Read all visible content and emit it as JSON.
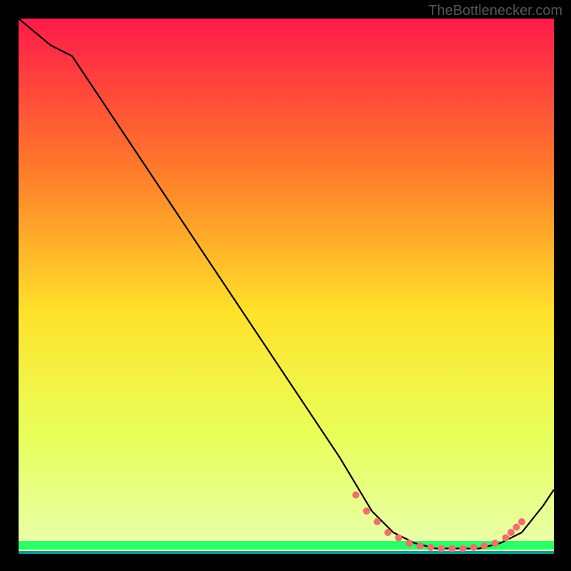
{
  "watermark": "TheBottlenecker.com",
  "chart_data": {
    "type": "line",
    "title": "",
    "xlabel": "",
    "ylabel": "",
    "xlim": [
      0,
      100
    ],
    "ylim": [
      0,
      100
    ],
    "background_gradient": {
      "top": "#ff1a4a",
      "mid_upper": "#ff7a2a",
      "mid": "#ffe22a",
      "mid_lower": "#e8ff5a",
      "bottom_band": "#2aff6a",
      "bottom_line": "#0a9a9a"
    },
    "series": [
      {
        "name": "curve",
        "color": "#000000",
        "x": [
          0,
          6,
          10,
          20,
          30,
          40,
          50,
          60,
          66,
          70,
          74,
          78,
          82,
          86,
          90,
          94,
          98,
          100
        ],
        "y": [
          100,
          95,
          93,
          78,
          63,
          48,
          33,
          18,
          8,
          4,
          2,
          1,
          1,
          1,
          2,
          4,
          9,
          12
        ]
      }
    ],
    "markers": {
      "name": "dots",
      "color": "#f26d6d",
      "x": [
        63,
        65,
        67,
        69,
        71,
        73,
        75,
        77,
        79,
        81,
        83,
        85,
        87,
        89,
        91,
        92,
        93,
        94
      ],
      "y": [
        11,
        8,
        6,
        4,
        3,
        2,
        1.5,
        1.2,
        1,
        1,
        1,
        1.2,
        1.5,
        2,
        3,
        4,
        5,
        6
      ]
    }
  }
}
